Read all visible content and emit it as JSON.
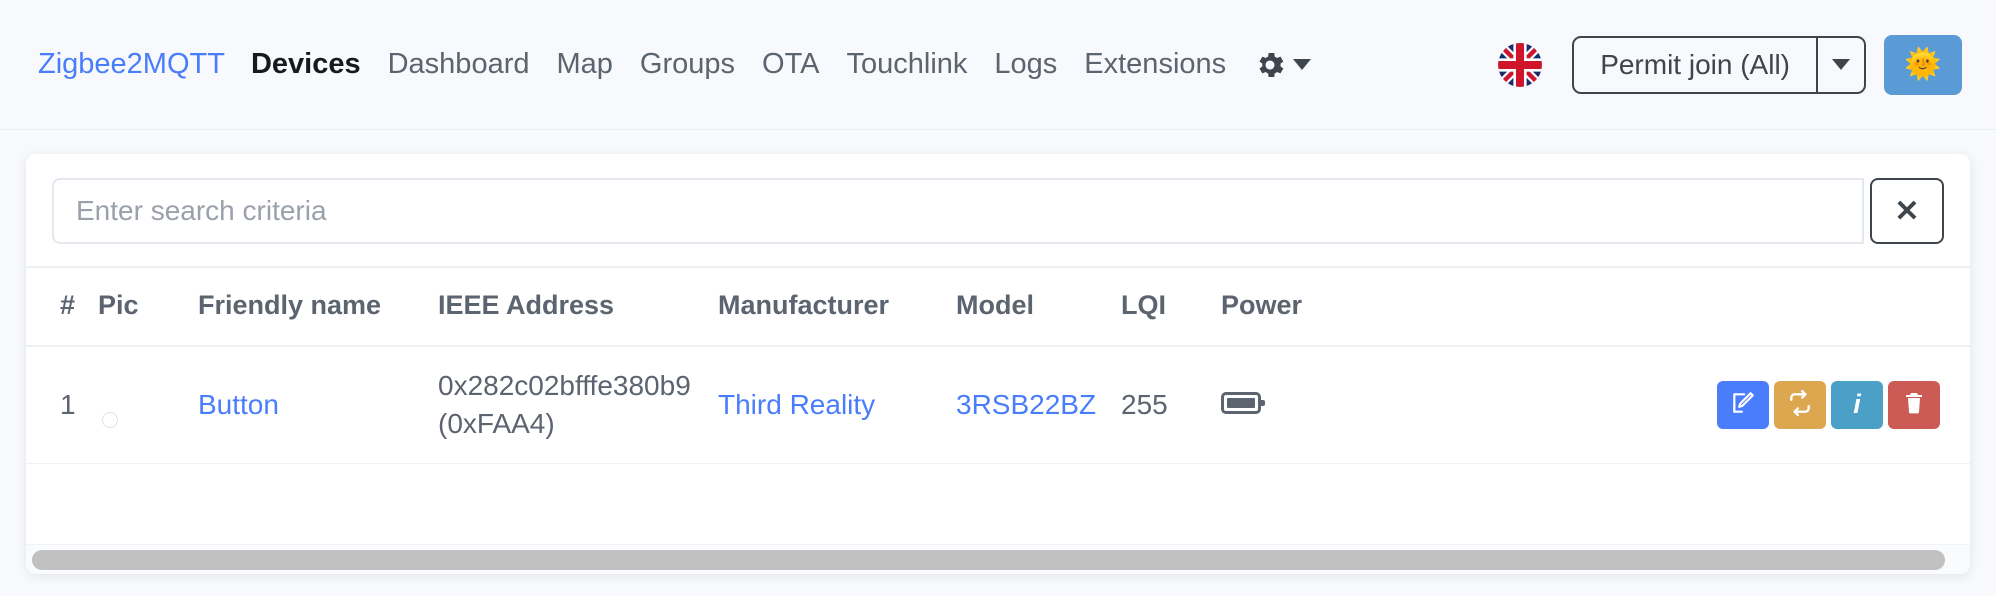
{
  "navbar": {
    "brand": "Zigbee2MQTT",
    "items": [
      {
        "label": "Devices",
        "active": true
      },
      {
        "label": "Dashboard",
        "active": false
      },
      {
        "label": "Map",
        "active": false
      },
      {
        "label": "Groups",
        "active": false
      },
      {
        "label": "OTA",
        "active": false
      },
      {
        "label": "Touchlink",
        "active": false
      },
      {
        "label": "Logs",
        "active": false
      },
      {
        "label": "Extensions",
        "active": false
      }
    ],
    "settings_icon": "gear-icon",
    "settings_caret_icon": "chevron-down-icon",
    "language_flag": "uk-flag-icon",
    "permit_join_label": "Permit join (All)",
    "permit_join_caret_icon": "chevron-down-icon",
    "theme_toggle_icon": "🌞",
    "theme_toggle_color": "#5b9bd5"
  },
  "search": {
    "value": "",
    "placeholder": "Enter search criteria",
    "clear_label": "✕"
  },
  "table": {
    "columns": [
      "#",
      "Pic",
      "Friendly name",
      "IEEE Address",
      "Manufacturer",
      "Model",
      "LQI",
      "Power"
    ],
    "rows": [
      {
        "index": "1",
        "pic": "device-thumbnail",
        "friendly_name": "Button",
        "ieee_address": "0x282c02bfffe380b9",
        "ieee_short": "(0xFAA4)",
        "manufacturer": "Third Reality",
        "model": "3RSB22BZ",
        "lqi": "255",
        "power": "battery-full-icon",
        "actions": [
          {
            "name": "edit",
            "icon": "pencil-square-icon",
            "color": "#4a7dfc"
          },
          {
            "name": "reload",
            "icon": "refresh-arrows-icon",
            "color": "#dca74e"
          },
          {
            "name": "info",
            "icon": "info-icon",
            "color": "#4ba0c8",
            "label": "i"
          },
          {
            "name": "delete",
            "icon": "trash-icon",
            "color": "#cc5a55"
          }
        ]
      }
    ]
  },
  "scrollbar": {
    "orientation": "horizontal",
    "position": 0
  },
  "colors": {
    "accent_link": "#4a7dfc",
    "text": "#5c6470",
    "page_bg": "#f7f9fc",
    "card_bg": "#ffffff"
  }
}
